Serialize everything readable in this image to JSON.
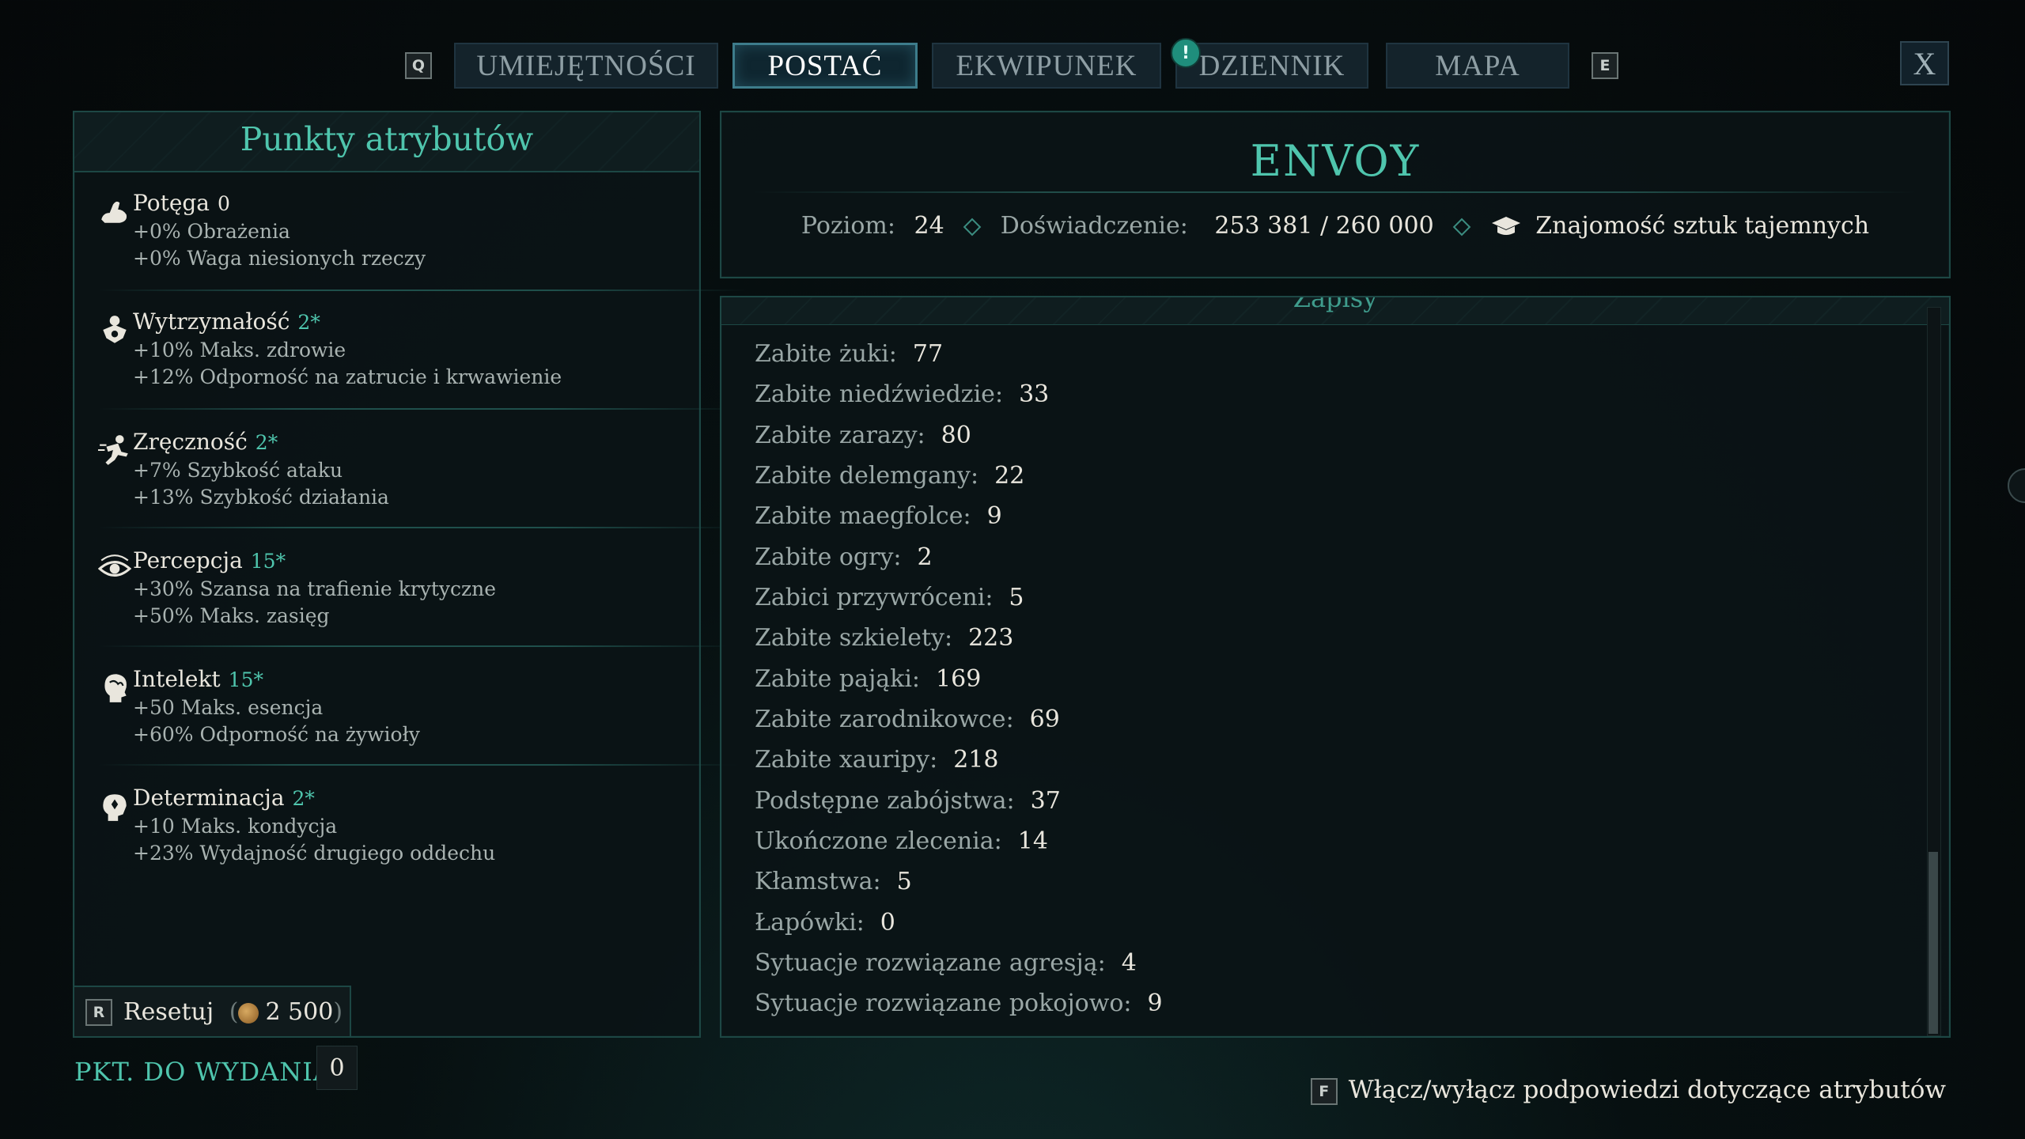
{
  "nav": {
    "prev_key": "Q",
    "next_key": "E",
    "tabs": [
      {
        "label": "UMIEJĘTNOŚCI",
        "active": false
      },
      {
        "label": "POSTAĆ",
        "active": true
      },
      {
        "label": "EKWIPUNEK",
        "active": false
      },
      {
        "label": "DZIENNIK",
        "active": false
      },
      {
        "label": "MAPA",
        "active": false
      }
    ],
    "notification_mark": "!",
    "close_label": "X"
  },
  "attributes": {
    "title": "Punkty atrybutów",
    "items": [
      {
        "name": "Potęga",
        "value": "0",
        "icon": "arm-strength-icon",
        "lines": [
          "+0% Obrażenia",
          "+0% Waga niesionych rzeczy"
        ]
      },
      {
        "name": "Wytrzymałość",
        "value": "2*",
        "icon": "constitution-icon",
        "lines": [
          "+10% Maks. zdrowie",
          "+12% Odporność na zatrucie i krwawienie"
        ]
      },
      {
        "name": "Zręczność",
        "value": "2*",
        "icon": "dexterity-runner-icon",
        "lines": [
          "+7% Szybkość ataku",
          "+13% Szybkość działania"
        ]
      },
      {
        "name": "Percepcja",
        "value": "15*",
        "icon": "perception-eye-icon",
        "lines": [
          "+30% Szansa na trafienie krytyczne",
          "+50% Maks. zasięg"
        ]
      },
      {
        "name": "Intelekt",
        "value": "15*",
        "icon": "intellect-head-icon",
        "lines": [
          "+50 Maks. esencja",
          "+60% Odporność na żywioły"
        ]
      },
      {
        "name": "Determinacja",
        "value": "2*",
        "icon": "resolve-head-icon",
        "lines": [
          "+10 Maks. kondycja",
          "+23% Wydajność drugiego oddechu"
        ]
      }
    ],
    "reset": {
      "key": "R",
      "label": "Resetuj",
      "cost": "2 500"
    },
    "points_label": "PKT. DO WYDANIA",
    "points_value": "0"
  },
  "character": {
    "name": "ENVOY",
    "level_label": "Poziom:",
    "level": "24",
    "xp_label": "Doświadczenie:",
    "xp": "253 381 / 260 000",
    "background": "Znajomość sztuk tajemnych"
  },
  "stats": {
    "section_title": "Zapisy",
    "rows": [
      {
        "label": "Zabite żuki:",
        "value": "77"
      },
      {
        "label": "Zabite niedźwiedzie:",
        "value": "33"
      },
      {
        "label": "Zabite zarazy:",
        "value": "80"
      },
      {
        "label": "Zabite delemgany:",
        "value": "22"
      },
      {
        "label": "Zabite maegfolce:",
        "value": "9"
      },
      {
        "label": "Zabite ogry:",
        "value": "2"
      },
      {
        "label": "Zabici przywróceni:",
        "value": "5"
      },
      {
        "label": "Zabite szkielety:",
        "value": "223"
      },
      {
        "label": "Zabite pająki:",
        "value": "169"
      },
      {
        "label": "Zabite zarodnikowce:",
        "value": "69"
      },
      {
        "label": "Zabite xauripy:",
        "value": "218"
      },
      {
        "label": "Podstępne zabójstwa:",
        "value": "37"
      },
      {
        "label": "Ukończone zlecenia:",
        "value": "14"
      },
      {
        "label": "Kłamstwa:",
        "value": "5"
      },
      {
        "label": "Łapówki:",
        "value": "0"
      },
      {
        "label": "Sytuacje rozwiązane agresją:",
        "value": "4"
      },
      {
        "label": "Sytuacje rozwiązane pokojowo:",
        "value": "9"
      }
    ]
  },
  "hint": {
    "key": "F",
    "label": "Włącz/wyłącz podpowiedzi dotyczące atrybutów"
  },
  "colors": {
    "accent": "#4fc5ad",
    "panel_border": "#1d4744",
    "tab_active_border": "#3d7c8b"
  }
}
